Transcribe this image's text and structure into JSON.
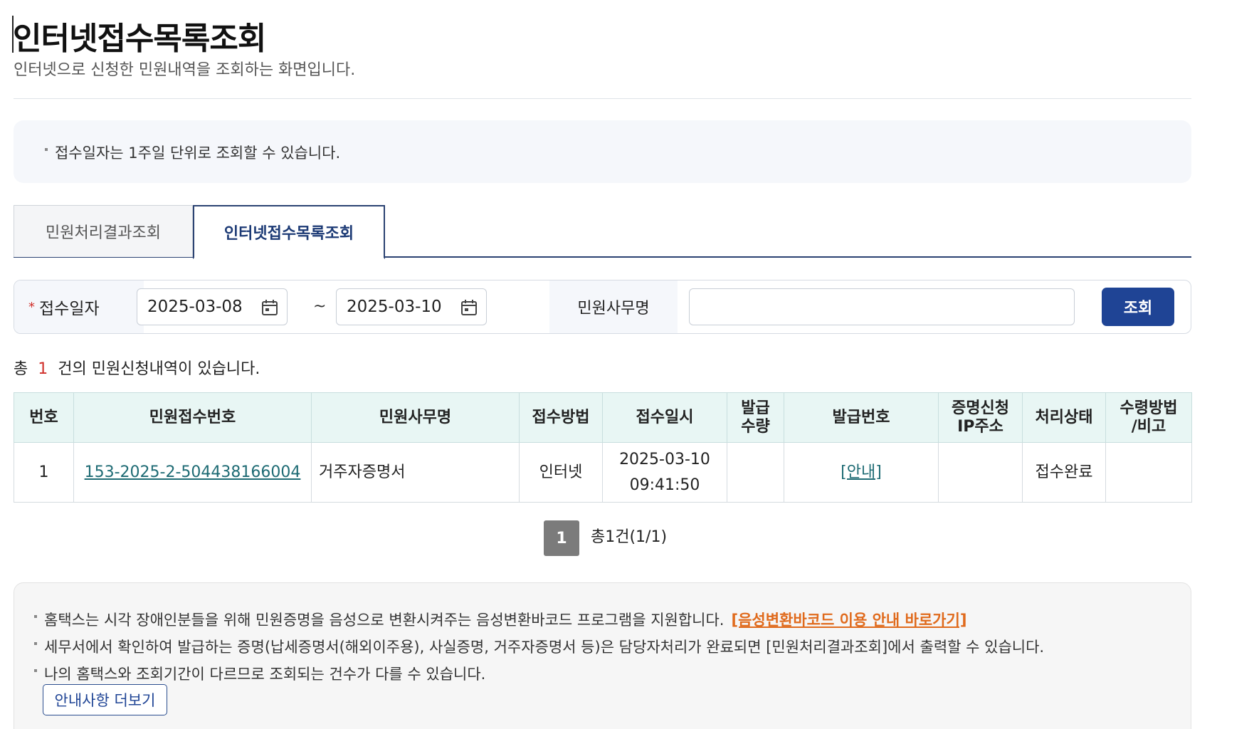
{
  "header": {
    "title": "인터넷접수목록조회",
    "subtitle": "인터넷으로 신청한 민원내역을 조회하는 화면입니다."
  },
  "notice": {
    "text": "접수일자는 1주일 단위로 조회할 수 있습니다."
  },
  "tabs": [
    {
      "label": "민원처리결과조회",
      "active": false
    },
    {
      "label": "인터넷접수목록조회",
      "active": true
    }
  ],
  "search": {
    "date_label": "접수일자",
    "required_mark": "*",
    "start_date": "2025-03-08",
    "end_date": "2025-03-10",
    "tilde": "~",
    "name_label": "민원사무명",
    "name_value": "",
    "button_label": "조회"
  },
  "summary": {
    "prefix": "총",
    "count": "1",
    "suffix": "건의 민원신청내역이 있습니다."
  },
  "table": {
    "headers": [
      "번호",
      "민원접수번호",
      "민원사무명",
      "접수방법",
      "접수일시",
      "발급\n수량",
      "발급번호",
      "증명신청\nIP주소",
      "처리상태",
      "수령방법\n/비고"
    ],
    "rows": [
      {
        "no": "1",
        "receipt_no": "153-2025-2-504438166004",
        "name": "거주자증명서",
        "method": "인터넷",
        "date": "2025-03-10",
        "time": "09:41:50",
        "qty": "",
        "issue_no": "[안내]",
        "ip": "",
        "status": "접수완료",
        "remark": ""
      }
    ]
  },
  "pager": {
    "current": "1",
    "total_text": "총1건(1/1)"
  },
  "info": {
    "line1": "홈택스는 시각 장애인분들을 위해 민원증명을 음성으로 변환시켜주는 음성변환바코드 프로그램을 지원합니다.",
    "line1_link": "[음성변환바코드 이용 안내 바로가기]",
    "line2": "세무서에서 확인하여 발급하는 증명(납세증명서(해외이주용), 사실증명, 거주자증명서 등)은 담당자처리가 완료되면 [민원처리결과조회]에서 출력할 수 있습니다.",
    "line3": "나의 홈택스와 조회기간이 다르므로 조회되는 건수가 다를 수 있습니다.",
    "more_button": "안내사항 더보기",
    "link_color": "#e06a1c"
  },
  "colors": {
    "primary": "#1f4495",
    "tab_border": "#2b4272",
    "header_bg": "#e8f6f4",
    "required": "#d0302b",
    "link": "#1e6b74"
  }
}
